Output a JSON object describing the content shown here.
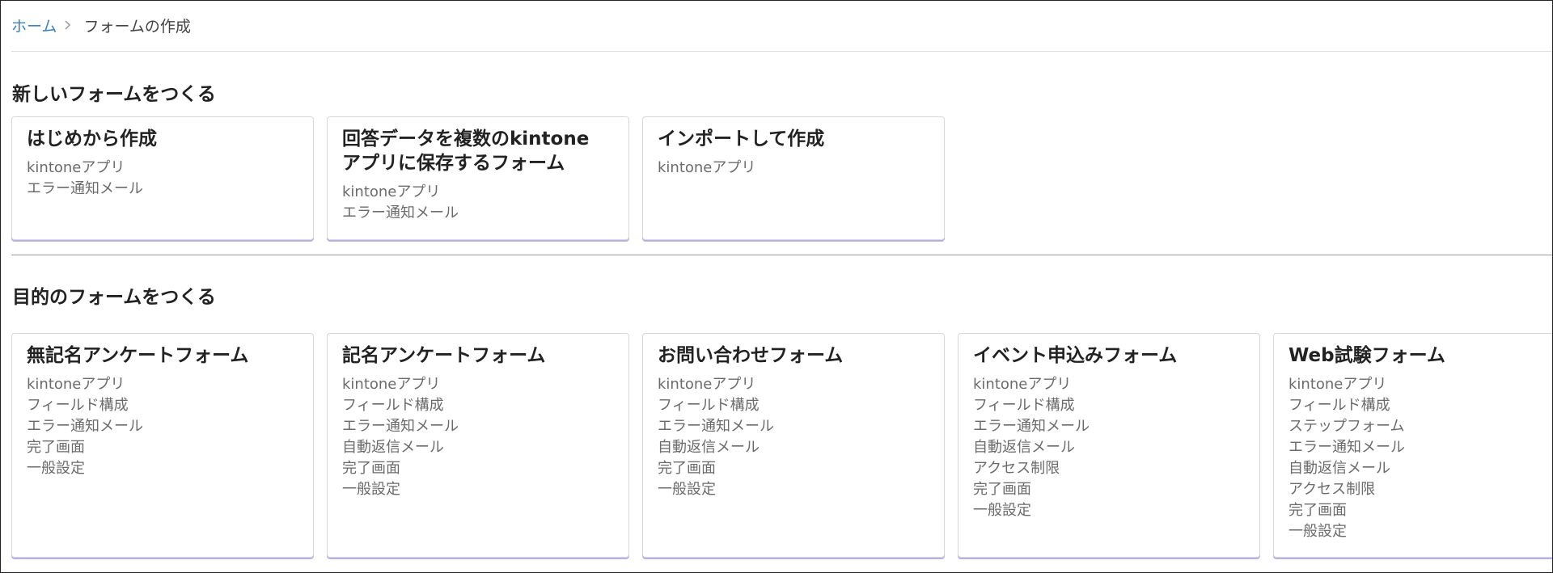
{
  "breadcrumb": {
    "home": "ホーム",
    "separator": ">",
    "current": "フォームの作成"
  },
  "sections": {
    "new": {
      "title": "新しいフォームをつくる",
      "cards": [
        {
          "title_lines": [
            "はじめから作成"
          ],
          "tags": [
            "kintoneアプリ",
            "エラー通知メール"
          ]
        },
        {
          "title_lines": [
            "回答データを複数のkintone",
            "アプリに保存するフォーム"
          ],
          "tags": [
            "kintoneアプリ",
            "エラー通知メール"
          ]
        },
        {
          "title_lines": [
            "インポートして作成"
          ],
          "tags": [
            "kintoneアプリ"
          ]
        }
      ]
    },
    "purpose": {
      "title": "目的のフォームをつくる",
      "cards": [
        {
          "title_lines": [
            "無記名アンケートフォーム"
          ],
          "tags": [
            "kintoneアプリ",
            "フィールド構成",
            "エラー通知メール",
            "完了画面",
            "一般設定"
          ]
        },
        {
          "title_lines": [
            "記名アンケートフォーム"
          ],
          "tags": [
            "kintoneアプリ",
            "フィールド構成",
            "エラー通知メール",
            "自動返信メール",
            "完了画面",
            "一般設定"
          ]
        },
        {
          "title_lines": [
            "お問い合わせフォーム"
          ],
          "tags": [
            "kintoneアプリ",
            "フィールド構成",
            "エラー通知メール",
            "自動返信メール",
            "完了画面",
            "一般設定"
          ]
        },
        {
          "title_lines": [
            "イベント申込みフォーム"
          ],
          "tags": [
            "kintoneアプリ",
            "フィールド構成",
            "エラー通知メール",
            "自動返信メール",
            "アクセス制限",
            "完了画面",
            "一般設定"
          ]
        },
        {
          "title_lines": [
            "Web試験フォーム"
          ],
          "tags": [
            "kintoneアプリ",
            "フィールド構成",
            "ステップフォーム",
            "エラー通知メール",
            "自動返信メール",
            "アクセス制限",
            "完了画面",
            "一般設定"
          ]
        }
      ]
    }
  },
  "colors": {
    "link": "#3b82c4",
    "card_accent": "#b9b0e6"
  }
}
